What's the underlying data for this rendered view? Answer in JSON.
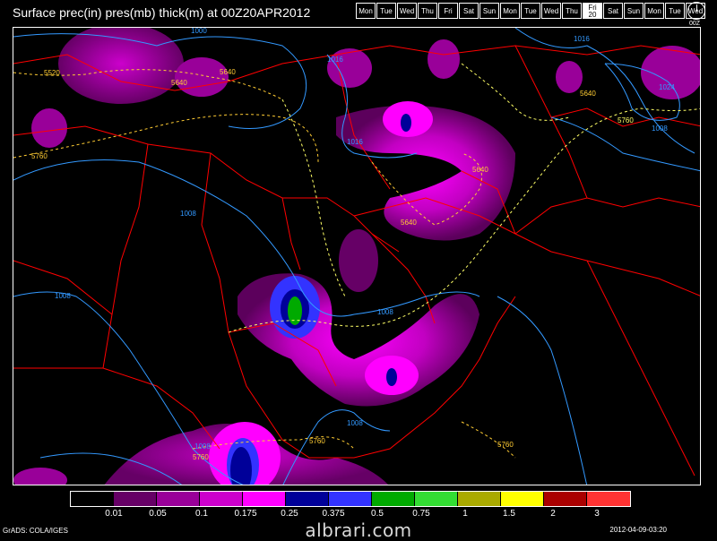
{
  "header": {
    "title": "Surface prec(in) pres(mb) thick(m) at 00Z20APR2012",
    "days": [
      {
        "label": "Mon"
      },
      {
        "label": "Tue"
      },
      {
        "label": "Wed"
      },
      {
        "label": "Thu"
      },
      {
        "label": "Fri"
      },
      {
        "label": "Sat"
      },
      {
        "label": "Sun"
      },
      {
        "label": "Mon"
      },
      {
        "label": "Tue"
      },
      {
        "label": "Wed"
      },
      {
        "label": "Thu"
      },
      {
        "label": "Fri",
        "sub": "20",
        "active": true
      },
      {
        "label": "Sat"
      },
      {
        "label": "Sun"
      },
      {
        "label": "Mon"
      },
      {
        "label": "Tue"
      },
      {
        "label": "Wed"
      }
    ],
    "clock_label": "00Z"
  },
  "map": {
    "colors": {
      "background": "#000000",
      "borders": "#ff0000",
      "pressure": "#3399ff",
      "thickness_warm": "#ffff66",
      "thickness_cold": "#ffcc33"
    },
    "pressure_labels": [
      "1000",
      "1016",
      "1016",
      "1016",
      "1024",
      "1008",
      "1008",
      "1008",
      "1008",
      "1008",
      "1008"
    ],
    "thickness_labels": [
      "5520",
      "5640",
      "5640",
      "5640",
      "5640",
      "5640",
      "5760",
      "5760",
      "5760",
      "5760",
      "5760"
    ]
  },
  "legend": {
    "colors": [
      "#000000",
      "#660066",
      "#990099",
      "#cc00cc",
      "#ff00ff",
      "#000099",
      "#3333ff",
      "#00aa00",
      "#33dd33",
      "#aaaa00",
      "#ffff00",
      "#aa0000",
      "#ff3333"
    ],
    "labels": [
      "0.01",
      "0.05",
      "0.1",
      "0.175",
      "0.25",
      "0.375",
      "0.5",
      "0.75",
      "1",
      "1.5",
      "2",
      "3"
    ]
  },
  "footer": {
    "left": "GrADS: COLA/IGES",
    "right": "2012-04-09-03:20",
    "watermark": "albrari.com"
  }
}
